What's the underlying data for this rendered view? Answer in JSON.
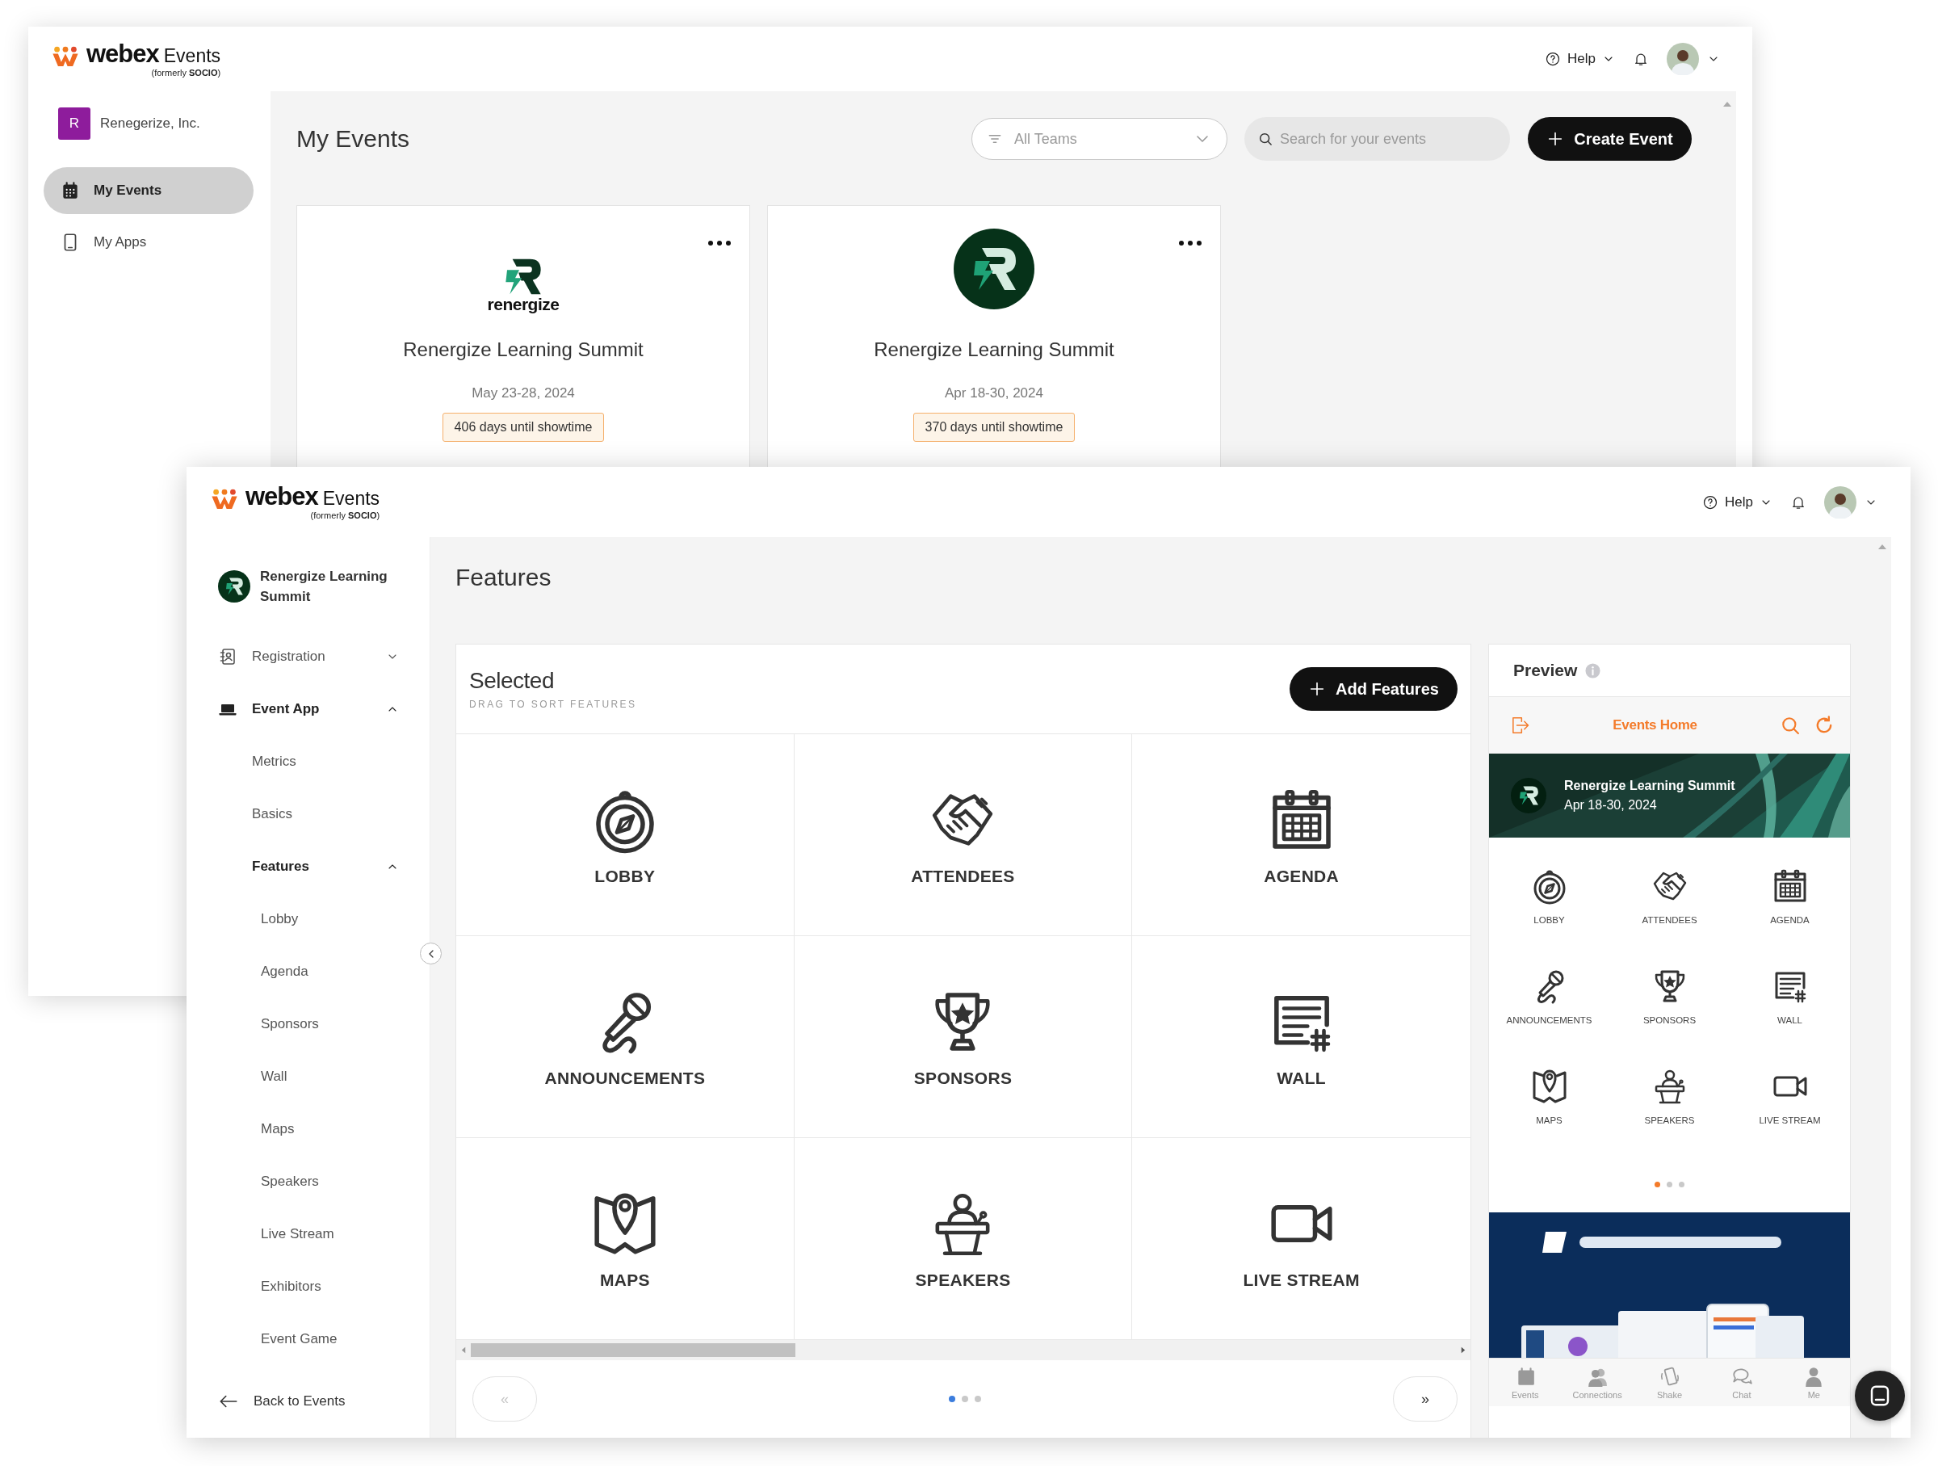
{
  "back_window": {
    "brand": {
      "name": "webex",
      "product": "Events",
      "tagline": "(formerly **SOCIO**)"
    },
    "help": "Help",
    "org": {
      "initial": "R",
      "name": "Renegerize, Inc."
    },
    "nav": [
      {
        "label": "My Events",
        "kind": "calendar",
        "selected": true
      },
      {
        "label": "My Apps",
        "kind": "phone",
        "selected": false
      }
    ],
    "title": "My Events",
    "team_filter": {
      "value": "All Teams"
    },
    "search": {
      "placeholder": "Search for your events"
    },
    "create_button": "Create Event",
    "events": [
      {
        "kind": "wordmark",
        "logo_text": "renergize",
        "name": "Renergize Learning Summit",
        "dates": "May 23-28, 2024",
        "countdown": "406 days until showtime"
      },
      {
        "kind": "circle",
        "name": "Renergize Learning Summit",
        "dates": "Apr 18-30, 2024",
        "countdown": "370 days until showtime"
      }
    ]
  },
  "front_window": {
    "brand": {
      "name": "webex",
      "product": "Events",
      "tagline": "(formerly **SOCIO**)"
    },
    "help": "Help",
    "event": {
      "name": "Renergize Learning Summit"
    },
    "nav": [
      {
        "label": "Registration",
        "kind": "contact",
        "expanded": false
      },
      {
        "label": "Event App",
        "kind": "laptop",
        "expanded": true,
        "children": [
          {
            "label": "Metrics"
          },
          {
            "label": "Basics"
          },
          {
            "label": "Features",
            "expanded": true,
            "children": [
              {
                "label": "Lobby"
              },
              {
                "label": "Agenda"
              },
              {
                "label": "Sponsors"
              },
              {
                "label": "Wall"
              },
              {
                "label": "Maps"
              },
              {
                "label": "Speakers"
              },
              {
                "label": "Live Stream"
              },
              {
                "label": "Exhibitors"
              },
              {
                "label": "Event Game"
              }
            ]
          }
        ]
      }
    ],
    "back_link": "Back to Events",
    "title": "Features",
    "selected_panel": {
      "title": "Selected",
      "subtitle": "DRAG TO SORT FEATURES",
      "add_button": "Add Features",
      "features": [
        {
          "label": "LOBBY",
          "kind": "compass"
        },
        {
          "label": "ATTENDEES",
          "kind": "handshake"
        },
        {
          "label": "AGENDA",
          "kind": "calendar"
        },
        {
          "label": "ANNOUNCEMENTS",
          "kind": "microphone"
        },
        {
          "label": "SPONSORS",
          "kind": "trophy"
        },
        {
          "label": "WALL",
          "kind": "wall"
        },
        {
          "label": "MAPS",
          "kind": "map"
        },
        {
          "label": "SPEAKERS",
          "kind": "podium"
        },
        {
          "label": "LIVE STREAM",
          "kind": "camera"
        }
      ],
      "prev": "«",
      "next": "»",
      "pages": [
        {
          "selected": true
        },
        {
          "selected": false
        },
        {
          "selected": false
        }
      ]
    },
    "preview": {
      "title": "Preview",
      "screen_title": "Events Home",
      "event_name": "Renergize Learning Summit",
      "event_dates": "Apr 18-30, 2024",
      "features": [
        {
          "label": "LOBBY",
          "kind": "compass"
        },
        {
          "label": "ATTENDEES",
          "kind": "handshake"
        },
        {
          "label": "AGENDA",
          "kind": "calendar"
        },
        {
          "label": "ANNOUNCEMENTS",
          "kind": "microphone"
        },
        {
          "label": "SPONSORS",
          "kind": "trophy"
        },
        {
          "label": "WALL",
          "kind": "wall"
        },
        {
          "label": "MAPS",
          "kind": "map"
        },
        {
          "label": "SPEAKERS",
          "kind": "podium"
        },
        {
          "label": "LIVE STREAM",
          "kind": "camera"
        }
      ],
      "pages": [
        {
          "selected": true
        },
        {
          "selected": false
        },
        {
          "selected": false
        }
      ],
      "tabs": [
        {
          "label": "Events",
          "kind": "calendar"
        },
        {
          "label": "Connections",
          "kind": "people"
        },
        {
          "label": "Shake",
          "kind": "shake"
        },
        {
          "label": "Chat",
          "kind": "chat"
        },
        {
          "label": "Me",
          "kind": "person"
        }
      ]
    }
  }
}
